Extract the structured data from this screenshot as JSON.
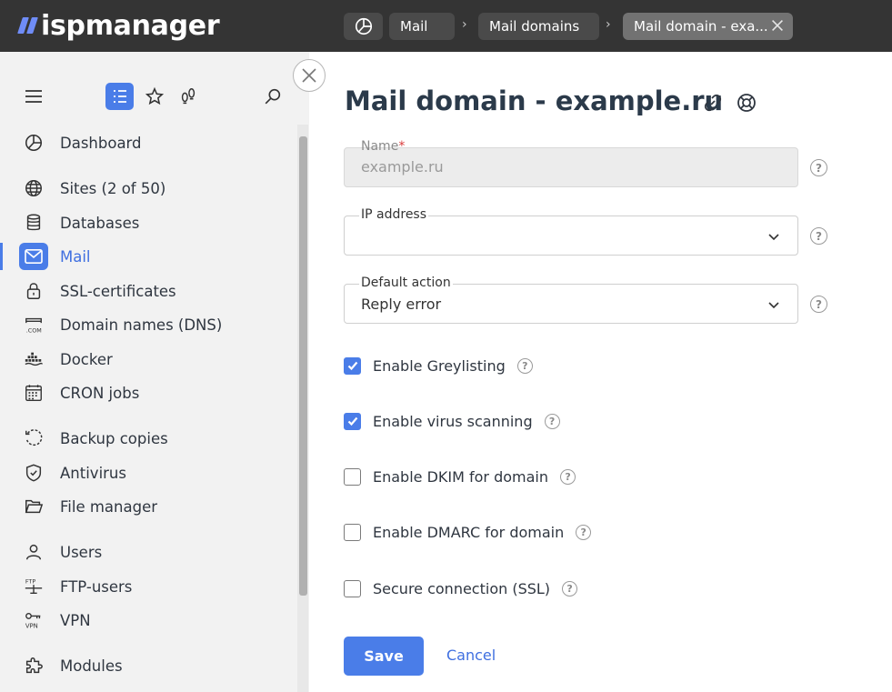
{
  "app": {
    "logo_text": "ispmanager"
  },
  "breadcrumb": {
    "items": [
      {
        "label": "Mail"
      },
      {
        "label": "Mail domains"
      },
      {
        "label": "Mail domain - exa..."
      }
    ]
  },
  "sidebar": {
    "items": [
      {
        "label": "Dashboard",
        "icon": "dashboard-icon"
      },
      {
        "label": "Sites (2 of 50)",
        "icon": "globe-icon"
      },
      {
        "label": "Databases",
        "icon": "database-icon"
      },
      {
        "label": "Mail",
        "icon": "mail-icon",
        "active": true
      },
      {
        "label": "SSL-certificates",
        "icon": "lock-icon"
      },
      {
        "label": "Domain names (DNS)",
        "icon": "dns-icon"
      },
      {
        "label": "Docker",
        "icon": "docker-icon"
      },
      {
        "label": "CRON jobs",
        "icon": "calendar-icon"
      },
      {
        "label": "Backup copies",
        "icon": "backup-icon"
      },
      {
        "label": "Antivirus",
        "icon": "shield-icon"
      },
      {
        "label": "File manager",
        "icon": "folder-icon"
      },
      {
        "label": "Users",
        "icon": "user-icon"
      },
      {
        "label": "FTP-users",
        "icon": "ftp-icon"
      },
      {
        "label": "VPN",
        "icon": "vpn-icon"
      },
      {
        "label": "Modules",
        "icon": "puzzle-icon"
      }
    ]
  },
  "page": {
    "title": "Mail domain - example.ru"
  },
  "form": {
    "name": {
      "label": "Name",
      "required_mark": "*",
      "value": "example.ru"
    },
    "ip": {
      "label": "IP address",
      "value": ""
    },
    "default_action": {
      "label": "Default action",
      "value": "Reply error"
    },
    "checkboxes": [
      {
        "label": "Enable Greylisting",
        "checked": true
      },
      {
        "label": "Enable virus scanning",
        "checked": true
      },
      {
        "label": "Enable DKIM for domain",
        "checked": false
      },
      {
        "label": "Enable DMARC for domain",
        "checked": false
      },
      {
        "label": "Secure connection (SSL)",
        "checked": false
      }
    ],
    "help_glyph": "?",
    "save_label": "Save",
    "cancel_label": "Cancel"
  },
  "colors": {
    "accent": "#4a7de8",
    "topbar": "#343434",
    "sidebar_bg": "#f2f2f2",
    "required": "#d93b3b"
  }
}
